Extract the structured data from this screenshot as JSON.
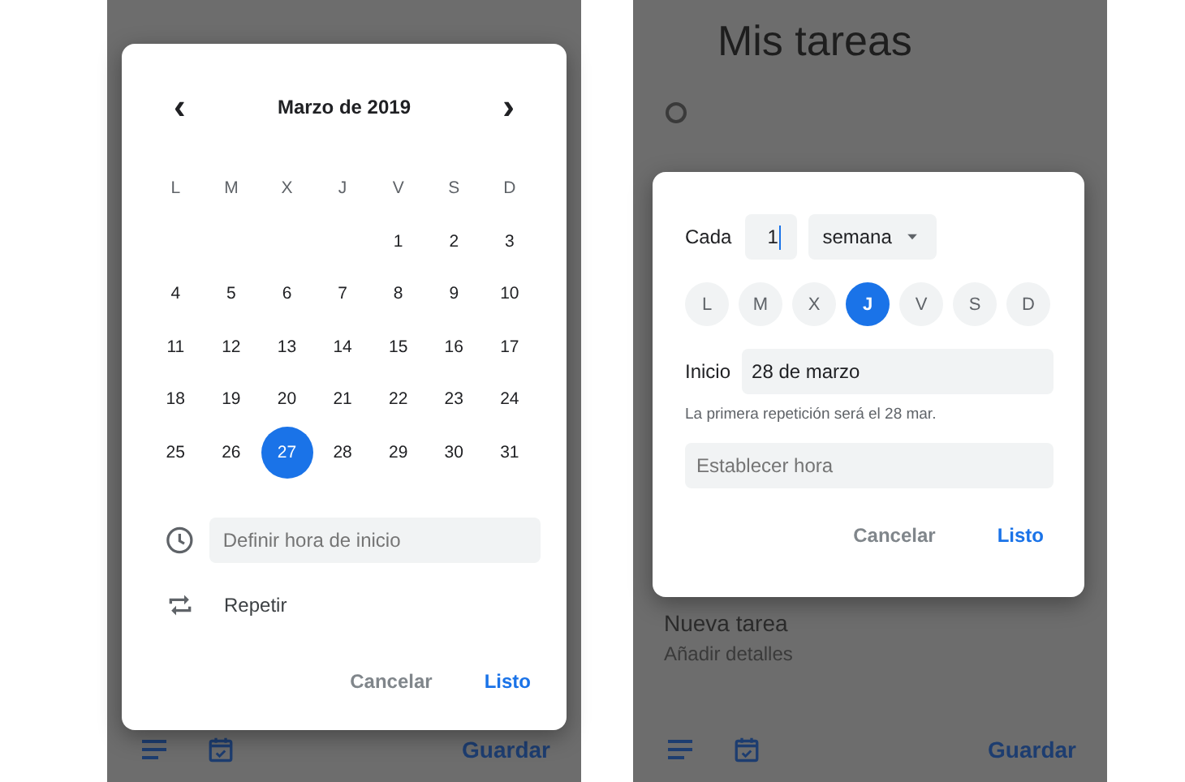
{
  "screens": [
    {
      "dialog": {
        "kind": "date_picker",
        "month": "Marzo de 2019",
        "prev": "‹",
        "next": "›",
        "weekdays": [
          "L",
          "M",
          "X",
          "J",
          "V",
          "S",
          "D"
        ],
        "weeks": [
          [
            {
              "label": "1",
              "selected": false
            },
            {
              "label": "2",
              "selected": false
            },
            {
              "label": "3",
              "selected": false
            }
          ],
          [
            {
              "label": "4",
              "selected": false
            },
            {
              "label": "5",
              "selected": false
            },
            {
              "label": "6",
              "selected": false
            },
            {
              "label": "7",
              "selected": false
            },
            {
              "label": "8",
              "selected": false
            },
            {
              "label": "9",
              "selected": false
            },
            {
              "label": "10",
              "selected": false
            }
          ],
          [
            {
              "label": "11",
              "selected": false
            },
            {
              "label": "12",
              "selected": false
            },
            {
              "label": "13",
              "selected": false
            },
            {
              "label": "14",
              "selected": false
            },
            {
              "label": "15",
              "selected": false
            },
            {
              "label": "16",
              "selected": false
            },
            {
              "label": "17",
              "selected": false
            }
          ],
          [
            {
              "label": "18",
              "selected": false
            },
            {
              "label": "19",
              "selected": false
            },
            {
              "label": "20",
              "selected": false
            },
            {
              "label": "21",
              "selected": false
            },
            {
              "label": "22",
              "selected": false
            },
            {
              "label": "23",
              "selected": false
            },
            {
              "label": "24",
              "selected": false
            }
          ],
          [
            {
              "label": "25",
              "selected": false
            },
            {
              "label": "26",
              "selected": false
            },
            {
              "label": "27",
              "selected": true
            },
            {
              "label": "28",
              "selected": false
            },
            {
              "label": "29",
              "selected": false
            },
            {
              "label": "30",
              "selected": false
            },
            {
              "label": "31",
              "selected": false
            }
          ]
        ],
        "time_placeholder": "Definir hora de inicio",
        "repeat_label": "Repetir",
        "buttons": [
          "Cancelar",
          "Listo"
        ]
      },
      "bottom_bar": {
        "save": "Guardar"
      }
    },
    {
      "title": "Mis tareas",
      "task": {
        "checked": false,
        "title": "Nueva tarea",
        "details": "Añadir detalles"
      },
      "dialog": {
        "kind": "repeat",
        "every_label": "Cada",
        "interval": "1",
        "unit": "semana",
        "days": [
          {
            "label": "L",
            "selected": false
          },
          {
            "label": "M",
            "selected": false
          },
          {
            "label": "X",
            "selected": false
          },
          {
            "label": "J",
            "selected": true
          },
          {
            "label": "V",
            "selected": false
          },
          {
            "label": "S",
            "selected": false
          },
          {
            "label": "D",
            "selected": false
          }
        ],
        "start_label": "Inicio",
        "start_value": "28 de marzo",
        "hint": "La primera repetición será el 28 mar.",
        "time_placeholder": "Establecer hora",
        "buttons": [
          "Cancelar",
          "Listo"
        ]
      },
      "bottom_bar": {
        "save": "Guardar"
      }
    }
  ]
}
